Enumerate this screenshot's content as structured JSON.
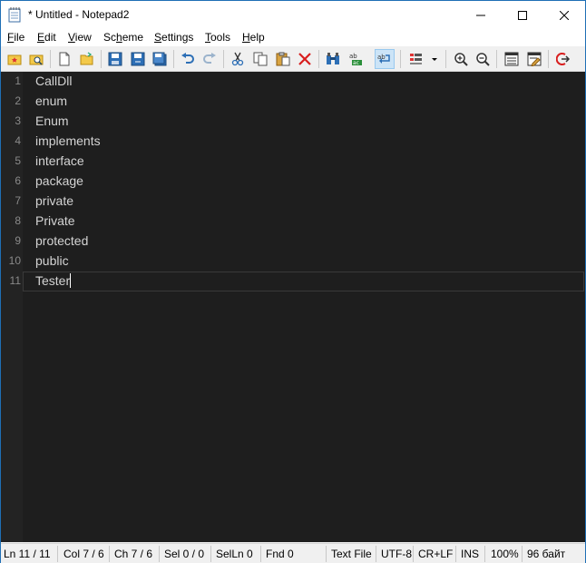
{
  "window": {
    "title": "* Untitled - Notepad2",
    "icon": "notepad-icon"
  },
  "window_controls": {
    "minimize": "minimize-icon",
    "maximize": "maximize-icon",
    "close": "close-icon"
  },
  "menu": {
    "items": [
      {
        "underline": "F",
        "rest": "ile"
      },
      {
        "underline": "E",
        "rest": "dit"
      },
      {
        "underline": "V",
        "rest": "iew"
      },
      {
        "underline": "",
        "pre": "Sc",
        "underline2": "h",
        "rest": "eme"
      },
      {
        "underline": "S",
        "rest": "ettings"
      },
      {
        "underline": "T",
        "rest": "ools"
      },
      {
        "underline": "H",
        "rest": "elp"
      }
    ]
  },
  "toolbar": {
    "buttons": [
      "favorites-icon",
      "browse-icon",
      "new-file-icon",
      "open-folder-icon",
      "save-icon",
      "save-as-icon",
      "save-copy-icon",
      "undo-icon",
      "redo-icon",
      "cut-icon",
      "copy-icon",
      "paste-icon",
      "delete-icon",
      "find-icon",
      "replace-icon",
      "word-wrap-icon",
      "scheme-icon",
      "zoom-in-icon",
      "zoom-out-icon",
      "scheme-config-icon",
      "settings-icon",
      "exit-icon"
    ],
    "active": "word-wrap-icon"
  },
  "editor": {
    "lines": [
      {
        "no": "1",
        "text": "CallDll"
      },
      {
        "no": "2",
        "text": "enum"
      },
      {
        "no": "3",
        "text": "Enum"
      },
      {
        "no": "4",
        "text": "implements"
      },
      {
        "no": "5",
        "text": "interface"
      },
      {
        "no": "6",
        "text": "package"
      },
      {
        "no": "7",
        "text": "private"
      },
      {
        "no": "8",
        "text": "Private"
      },
      {
        "no": "9",
        "text": "protected"
      },
      {
        "no": "10",
        "text": "public"
      },
      {
        "no": "11",
        "text": "Tester"
      }
    ],
    "current_line": 11,
    "colors": {
      "background": "#1e1e1e",
      "text": "#d4d4d4",
      "gutter_text": "#8a8a8a"
    }
  },
  "status": {
    "ln": "Ln 11 / 11",
    "col": "Col 7 / 6",
    "ch": "Ch 7 / 6",
    "sel": "Sel 0 / 0",
    "selln": "SelLn 0",
    "fnd": "Fnd 0",
    "filetype": "Text File",
    "encoding": "UTF-8",
    "eol": "CR+LF",
    "mode": "INS",
    "zoom": "100%",
    "size": "96 байт"
  }
}
